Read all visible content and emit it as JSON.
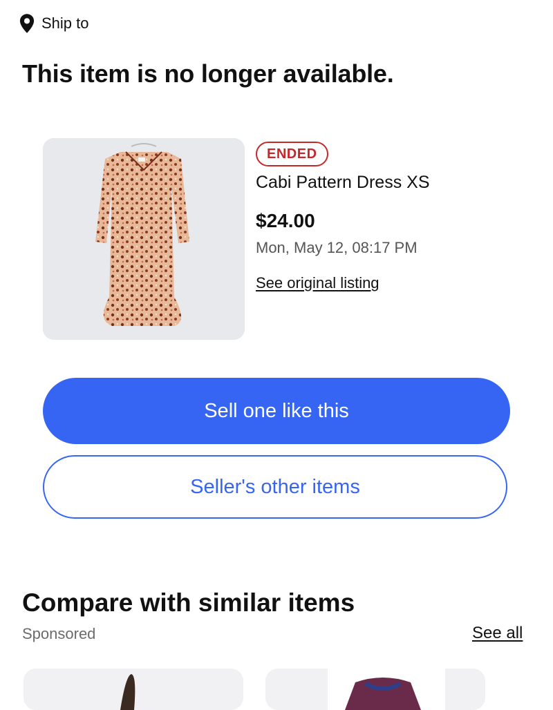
{
  "header": {
    "ship_to_label": "Ship to",
    "location_icon": "map-pin-icon"
  },
  "headline": "This item is no longer available.",
  "item": {
    "status_badge": "ENDED",
    "title": "Cabi Pattern Dress XS",
    "price": "$24.00",
    "ended_date": "Mon, May 12, 08:17 PM",
    "original_listing_link": "See original listing"
  },
  "actions": {
    "primary_label": "Sell one like this",
    "secondary_label": "Seller's other items"
  },
  "compare": {
    "title": "Compare with similar items",
    "sponsored_label": "Sponsored",
    "see_all_label": "See all"
  },
  "colors": {
    "accent": "#3665f3",
    "ended_badge": "#c5282b",
    "text": "#111820",
    "muted": "#555555"
  }
}
